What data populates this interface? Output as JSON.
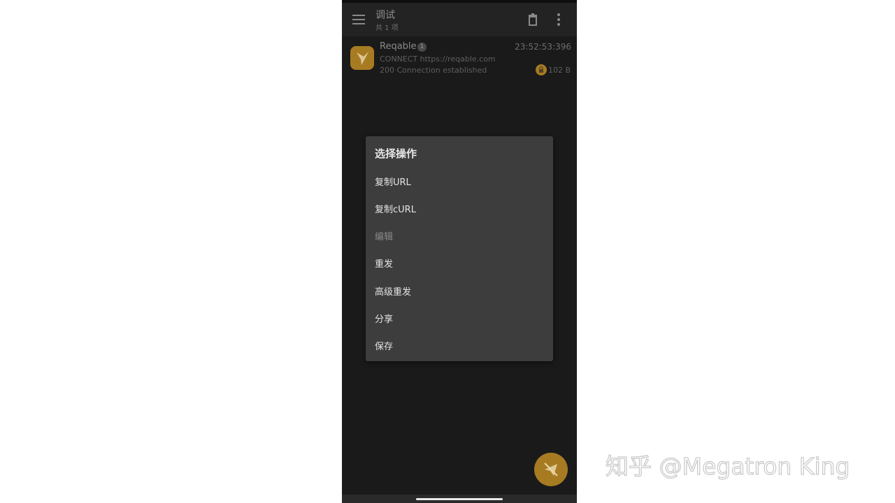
{
  "appbar": {
    "title": "调试",
    "subtitle": "共 1 项",
    "menu_icon": "hamburger-menu-icon",
    "delete_icon": "trash-icon",
    "more_icon": "more-vert-icon"
  },
  "list": {
    "items": [
      {
        "name": "Reqable",
        "count": "1",
        "time": "23:52:53:396",
        "request": "CONNECT https://reqable.com",
        "status": "200 Connection established",
        "size": "102 B",
        "avatar_icon": "hummingbird-logo-icon",
        "lock_icon": "lock-icon"
      }
    ]
  },
  "dialog": {
    "title": "选择操作",
    "options": [
      {
        "label": "复制URL",
        "enabled": true
      },
      {
        "label": "复制cURL",
        "enabled": true
      },
      {
        "label": "编辑",
        "enabled": false
      },
      {
        "label": "重发",
        "enabled": true
      },
      {
        "label": "高级重发",
        "enabled": true
      },
      {
        "label": "分享",
        "enabled": true
      },
      {
        "label": "保存",
        "enabled": true
      }
    ]
  },
  "fab": {
    "icon": "send-off-icon"
  },
  "watermark": {
    "text": "知乎 @Megatron King"
  },
  "colors": {
    "accent": "#a77b22",
    "background": "#1a1a1a",
    "dialog": "#3d3d3d"
  }
}
